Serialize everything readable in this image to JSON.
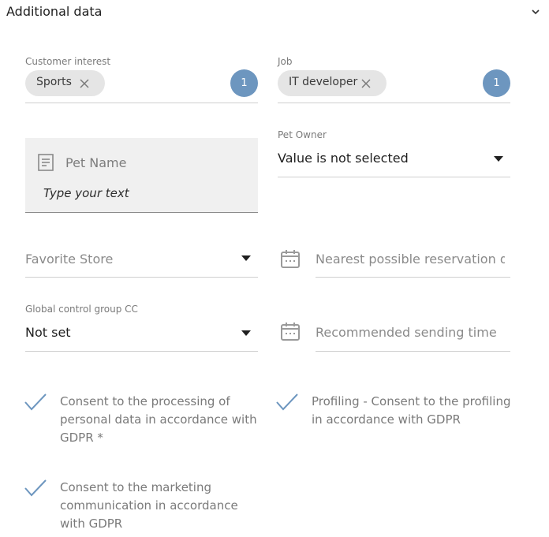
{
  "section": {
    "title": "Additional data"
  },
  "customer_interest": {
    "label": "Customer interest",
    "chip": "Sports",
    "count": "1"
  },
  "job": {
    "label": "Job",
    "chip": "IT developer",
    "count": "1"
  },
  "pet_name": {
    "label": "Pet Name",
    "value": "Type your text"
  },
  "pet_owner": {
    "label": "Pet Owner",
    "value": "Value is not selected"
  },
  "favorite_store": {
    "placeholder": "Favorite Store"
  },
  "nearest_reservation": {
    "placeholder": "Nearest possible reservation date"
  },
  "global_control_group": {
    "label": "Global control group CC",
    "value": "Not set"
  },
  "recommended_sending_time": {
    "placeholder": "Recommended sending time"
  },
  "consents": [
    {
      "text": "Consent to the processing of personal data in accordance with GDPR *"
    },
    {
      "text": "Profiling - Consent to the profiling in accordance with GDPR"
    },
    {
      "text": "Consent to the marketing communication in accordance with GDPR"
    }
  ],
  "colors": {
    "accent": "#6d96bf",
    "chip_bg": "#e5e5e5",
    "field_bg": "#f0f0f0"
  }
}
